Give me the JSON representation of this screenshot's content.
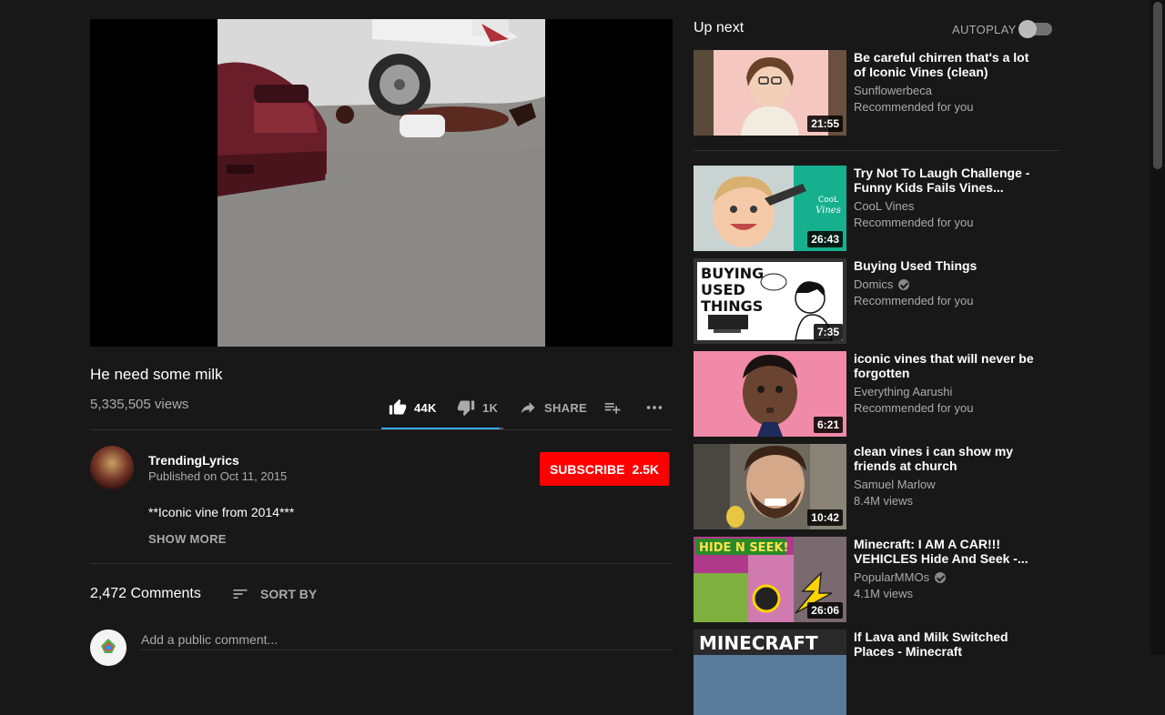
{
  "video": {
    "title": "He need some milk",
    "views": "5,335,505 views"
  },
  "actions": {
    "like_count": "44K",
    "dislike_count": "1K",
    "share_label": "SHARE",
    "like_ratio": 0.97
  },
  "owner": {
    "channel": "TrendingLyrics",
    "published": "Published on Oct 11, 2015",
    "subscribe_label": "SUBSCRIBE",
    "subscriber_count": "2.5K",
    "description": "**Iconic vine from 2014***",
    "show_more": "SHOW MORE"
  },
  "comments": {
    "count": "2,472 Comments",
    "sort_label": "SORT BY",
    "placeholder": "Add a public comment..."
  },
  "sidebar": {
    "up_next": "Up next",
    "autoplay_label": "AUTOPLAY",
    "autoplay_on": false,
    "items": [
      {
        "title": "Be careful chirren that's a lot of Iconic Vines (clean)",
        "channel": "Sunflowerbeca",
        "meta": "Recommended for you",
        "duration": "21:55",
        "verified": false
      },
      {
        "title": "Try Not To Laugh Challenge - Funny Kids Fails Vines...",
        "channel": "CooL Vines",
        "meta": "Recommended for you",
        "duration": "26:43",
        "verified": false
      },
      {
        "title": "Buying Used Things",
        "channel": "Domics",
        "meta": "Recommended for you",
        "duration": "7:35",
        "verified": true
      },
      {
        "title": "iconic vines that will never be forgotten",
        "channel": "Everything Aarushi",
        "meta": "Recommended for you",
        "duration": "6:21",
        "verified": false
      },
      {
        "title": "clean vines i can show my friends at church",
        "channel": "Samuel Marlow",
        "meta": "8.4M views",
        "duration": "10:42",
        "verified": false
      },
      {
        "title": "Minecraft: I AM A CAR!!! VEHICLES Hide And Seek -...",
        "channel": "PopularMMOs",
        "meta": "4.1M views",
        "duration": "26:06",
        "verified": true
      },
      {
        "title": "If Lava and Milk Switched Places - Minecraft",
        "channel": "",
        "meta": "",
        "duration": "",
        "verified": false
      }
    ],
    "thumb_text": {
      "buying": "BUYING USED THINGS",
      "cool": "CooL Vines",
      "hide": "HIDE N SEEK!",
      "minecraft": "MINECRAFT"
    }
  },
  "icons": [
    "like-icon",
    "dislike-icon",
    "share-icon",
    "add-to-playlist-icon",
    "more-icon",
    "sort-icon",
    "verified-icon"
  ],
  "colors": {
    "background": "#181818",
    "subscribe": "#ff0000",
    "accent": "#3ea6ff",
    "secondary_text": "#aaaaaa"
  }
}
